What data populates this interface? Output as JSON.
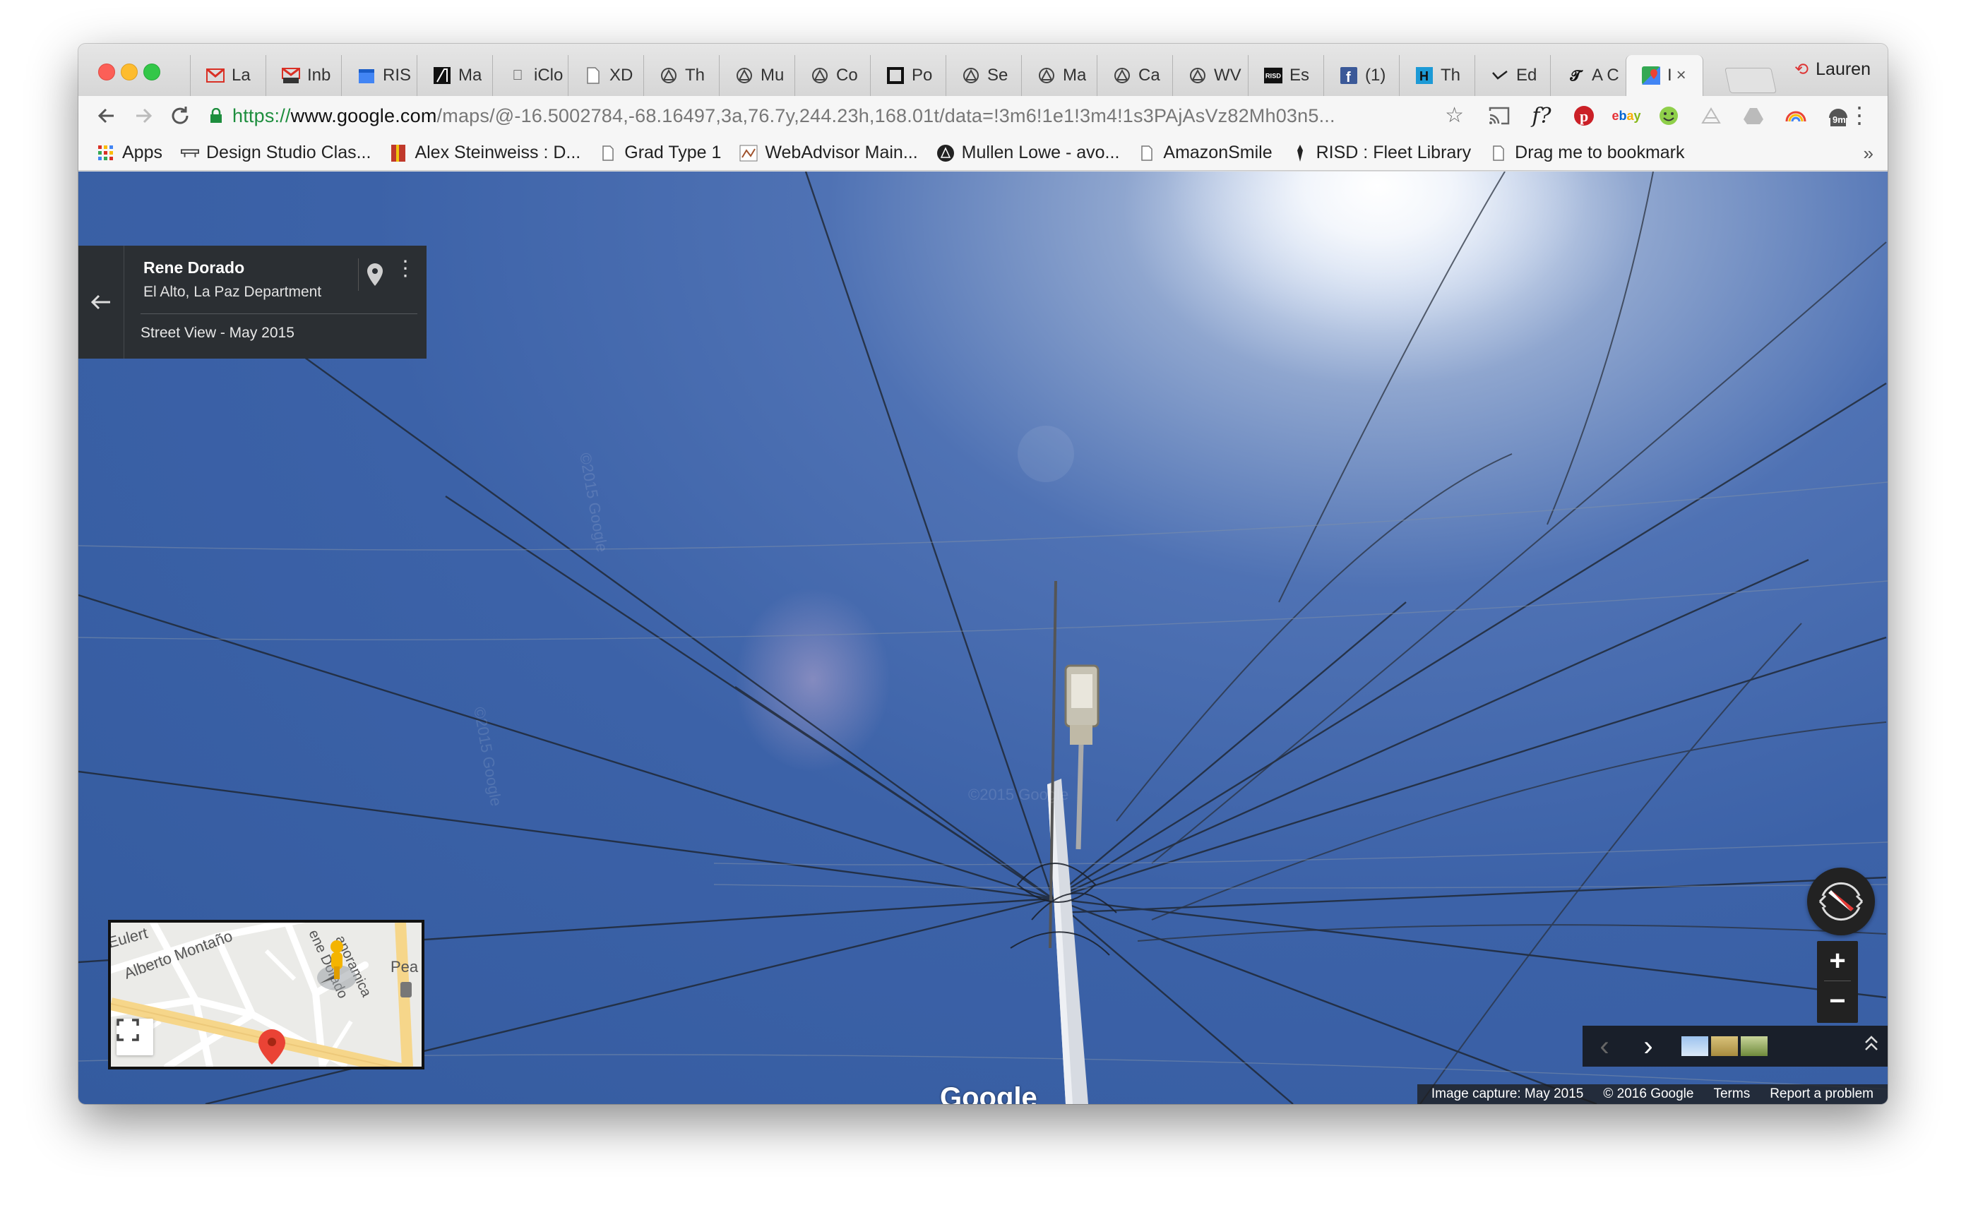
{
  "tabs": [
    {
      "favicon": "gmail-icon",
      "title": "La"
    },
    {
      "favicon": "gmail-inbox-icon",
      "title": "Inb"
    },
    {
      "favicon": "calendar-icon",
      "title": "RIS"
    },
    {
      "favicon": "a-logo-icon",
      "title": "Ma"
    },
    {
      "favicon": "apple-icon",
      "title": "iClo"
    },
    {
      "favicon": "page-icon",
      "title": "XD"
    },
    {
      "favicon": "tripod-icon",
      "title": "Th"
    },
    {
      "favicon": "tripod-icon",
      "title": "Mu"
    },
    {
      "favicon": "tripod-icon",
      "title": "Co"
    },
    {
      "favicon": "square-icon",
      "title": "Po"
    },
    {
      "favicon": "tripod-icon",
      "title": "Se"
    },
    {
      "favicon": "tripod-icon",
      "title": "Ma"
    },
    {
      "favicon": "tripod-icon",
      "title": "Ca"
    },
    {
      "favicon": "tripod-icon",
      "title": "WV"
    },
    {
      "favicon": "risd-icon",
      "title": "Es"
    },
    {
      "favicon": "facebook-icon",
      "title": "(1)"
    },
    {
      "favicon": "h-icon",
      "title": "Th"
    },
    {
      "favicon": "check-icon",
      "title": "Ed"
    },
    {
      "favicon": "nyt-icon",
      "title": "A C"
    },
    {
      "favicon": "maps-icon",
      "title": "I",
      "active": true
    }
  ],
  "profile_name": "Lauren",
  "url": {
    "scheme": "https://",
    "host": "www.google.com",
    "path": "/maps/@-16.5002784,-68.16497,3a,76.7y,244.23h,168.01t/data=!3m6!1e1!3m4!1s3PAjAsVz82Mh03n5..."
  },
  "extensions": [
    "cast-icon",
    "fquestion-icon",
    "pinterest-icon",
    "ebay-icon",
    "smiley-icon",
    "triangle-icon",
    "drive-icon",
    "rainbow-icon",
    "timer-icon"
  ],
  "extension_timer_label": "9m",
  "bookmarks": [
    {
      "icon": "apps-grid-icon",
      "label": "Apps"
    },
    {
      "icon": "ruler-icon",
      "label": "Design Studio Clas..."
    },
    {
      "icon": "book-icon",
      "label": "Alex Steinweiss : D..."
    },
    {
      "icon": "page-icon",
      "label": "Grad Type 1"
    },
    {
      "icon": "webadvisor-icon",
      "label": "WebAdvisor Main..."
    },
    {
      "icon": "mullen-icon",
      "label": "Mullen Lowe - avo..."
    },
    {
      "icon": "page-icon",
      "label": "AmazonSmile"
    },
    {
      "icon": "risd-icon",
      "label": "RISD : Fleet Library"
    },
    {
      "icon": "page-icon",
      "label": "Drag me to bookmark"
    }
  ],
  "bookmarks_more": "»",
  "streetview": {
    "place_name": "Rene Dorado",
    "place_address": "El Alto, La Paz Department",
    "capture_label": "Street View - May 2015",
    "watermark": "Google"
  },
  "minimap": {
    "street_1": "Eulert",
    "street_2": "Alberto Montaño",
    "street_3": "ene Dorado",
    "street_4": "anoramica",
    "street_5": "Pea"
  },
  "footer": {
    "capture": "Image capture: May 2015",
    "copyright": "© 2016 Google",
    "terms": "Terms",
    "report": "Report a problem"
  },
  "controls": {
    "zoom_in": "+",
    "zoom_out": "−",
    "prev": "‹",
    "next": "›",
    "collapse": "⌃"
  },
  "colors": {
    "sky": "#3c62a8",
    "secure_green": "#1e8e3e",
    "pin_red": "#ea4335",
    "pegman_yellow": "#f4b400"
  }
}
